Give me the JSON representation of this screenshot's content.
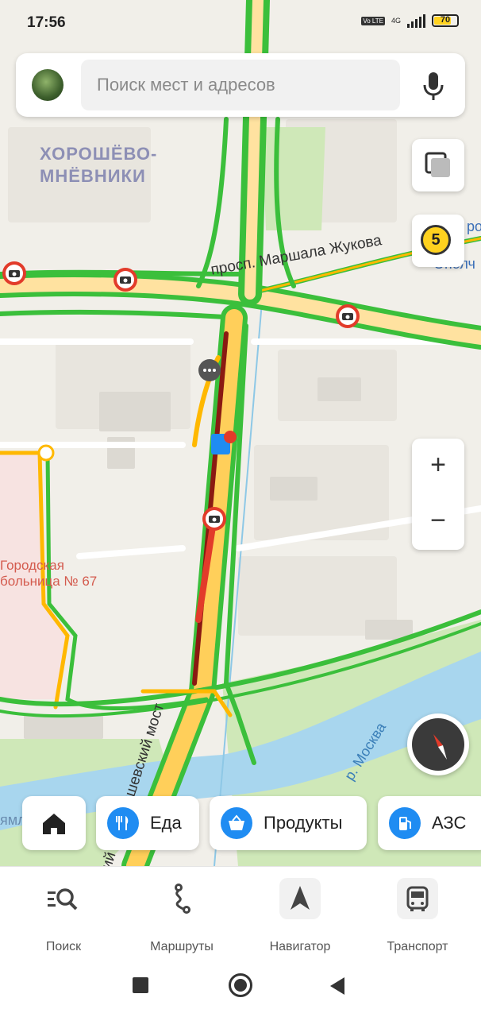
{
  "status_bar": {
    "time": "17:56",
    "network": "4G",
    "volte": "Vo LTE",
    "battery": "70"
  },
  "search": {
    "placeholder": "Поиск мест и адресов",
    "avatar_icon": "user-avatar",
    "mic_icon": "microphone-icon"
  },
  "map": {
    "district_line1": "ХОРОШЁВО-",
    "district_line2": "МНЁВНИКИ",
    "street_main": "просп. Маршала Жукова",
    "bridge": "ий Карамышевский мост",
    "river": "р. Москва",
    "hospital_line1": "Городская",
    "hospital_line2": "больница № 67",
    "edge_label_top": "род",
    "edge_label_bottom": "Ополч",
    "edge_label_left": "ямле"
  },
  "controls": {
    "traffic_level": "5",
    "zoom_in": "+",
    "zoom_out": "−"
  },
  "chips": [
    {
      "label": "",
      "icon": "home-icon"
    },
    {
      "label": "Еда",
      "icon": "fork-knife-icon"
    },
    {
      "label": "Продукты",
      "icon": "basket-icon"
    },
    {
      "label": "АЗС",
      "icon": "fuel-pump-icon"
    }
  ],
  "bottom_nav": [
    {
      "label": "Поиск",
      "icon": "search-list-icon"
    },
    {
      "label": "Маршруты",
      "icon": "route-icon"
    },
    {
      "label": "Навигатор",
      "icon": "navigator-arrow-icon"
    },
    {
      "label": "Транспорт",
      "icon": "bus-icon"
    }
  ],
  "colors": {
    "traffic_green": "#3bbf3b",
    "traffic_yellow": "#ffb800",
    "traffic_red": "#e23b2a",
    "traffic_dark_red": "#8a1a12",
    "accent_blue": "#1f8cf2",
    "water": "#a8d6ee",
    "park": "#cfe8b8"
  }
}
